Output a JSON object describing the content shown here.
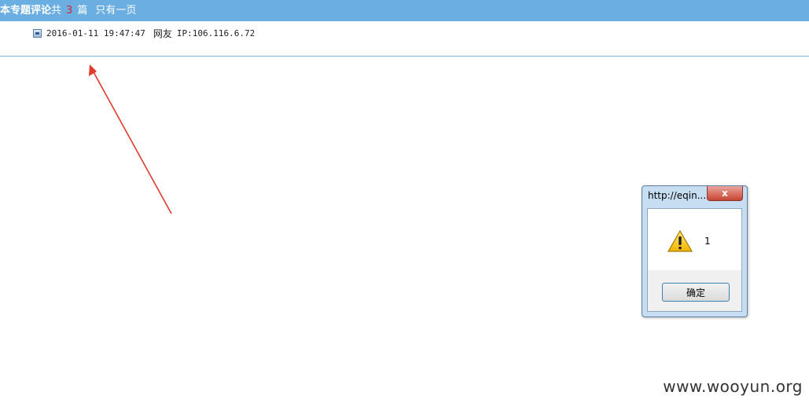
{
  "topbar": {
    "title": "本专题评论",
    "prefix": "共",
    "count": "3",
    "suffix": "篇",
    "pages": "只有一页"
  },
  "comment": {
    "datetime": "2016-01-11 19:47:47",
    "user": "网友",
    "ip": "IP:106.116.6.72"
  },
  "dialog": {
    "title": "http://eqin...",
    "close": "x",
    "message": "1",
    "ok_label": "确定",
    "icon": "warning-icon"
  },
  "watermark": "www.wooyun.org",
  "colors": {
    "topbar": "#6aaee2",
    "count": "#d9272b",
    "arrow": "#e23a2c",
    "close_button": "#c84532"
  }
}
